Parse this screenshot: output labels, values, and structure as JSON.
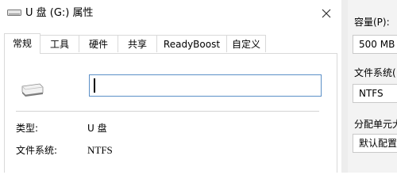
{
  "dialog": {
    "title": "U 盘 (G:) 属性",
    "title_icon": "drive-icon",
    "close_icon": "close-icon",
    "tabs": [
      {
        "label": "常规",
        "active": true
      },
      {
        "label": "工具",
        "active": false
      },
      {
        "label": "硬件",
        "active": false
      },
      {
        "label": "共享",
        "active": false
      },
      {
        "label": "ReadyBoost",
        "active": false
      },
      {
        "label": "自定义",
        "active": false
      }
    ],
    "general": {
      "drive_icon": "usb-drive-icon",
      "name_value": "",
      "type_label": "类型:",
      "type_value": "U 盘",
      "fs_label": "文件系统:",
      "fs_value": "NTFS"
    }
  },
  "format_window": {
    "capacity_label": "容量(P):",
    "capacity_value": "500 MB",
    "fs_label": "文件系统(",
    "fs_value": "NTFS",
    "alloc_label": "分配单元大",
    "alloc_value": "默认配置"
  }
}
